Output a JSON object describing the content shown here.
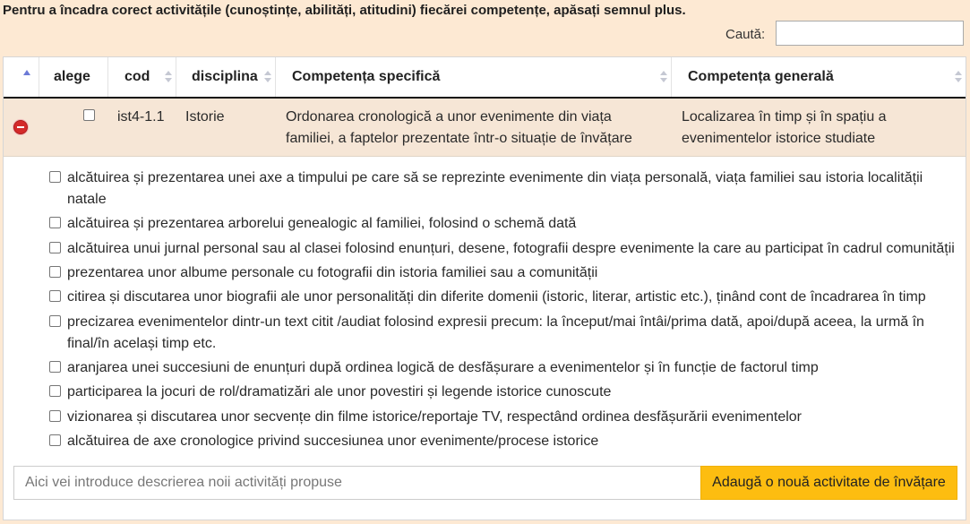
{
  "header": {
    "instructions": "Pentru a încadra corect activitățile (cunoștințe, abilități, atitudini) fiecărei competențe, apăsați semnul plus."
  },
  "search": {
    "label": "Caută:",
    "value": "",
    "placeholder": ""
  },
  "table": {
    "columns": {
      "alege": "alege",
      "cod": "cod",
      "disciplina": "disciplina",
      "competenta_specifica": "Competența specifică",
      "competenta_generala": "Competența generală"
    },
    "row": {
      "checked": false,
      "cod": "ist4-1.1",
      "disciplina": "Istorie",
      "competenta_specifica": "Ordonarea cronologică a unor evenimente din viața familiei, a faptelor prezentate într-o situație de învățare",
      "competenta_generala": "Localizarea în timp și în spațiu a evenimentelor istorice studiate"
    }
  },
  "activities": [
    {
      "text": "alcătuirea și prezentarea unei axe a timpului pe care să se reprezinte evenimente din viața personală, viața familiei sau istoria localității natale",
      "checked": false
    },
    {
      "text": "alcătuirea și prezentarea arborelui genealogic al familiei, folosind o schemă dată",
      "checked": false
    },
    {
      "text": "alcătuirea unui jurnal personal sau al clasei folosind enunțuri, desene, fotografii despre evenimente la care au participat în cadrul comunității",
      "checked": false
    },
    {
      "text": "prezentarea unor albume personale cu fotografii din istoria familiei sau a comunității",
      "checked": false
    },
    {
      "text": "citirea și discutarea unor biografii ale unor personalități din diferite domenii (istoric, literar, artistic etc.), ținând cont de încadrarea în timp",
      "checked": false
    },
    {
      "text": "precizarea evenimentelor dintr-un text citit /audiat folosind expresii precum: la început/mai întâi/prima dată, apoi/după aceea, la urmă în final/în același timp etc.",
      "checked": false
    },
    {
      "text": "aranjarea unei succesiuni de enunțuri după ordinea logică de desfășurare a evenimentelor și în funcție de factorul timp",
      "checked": false
    },
    {
      "text": "participarea la jocuri de rol/dramatizări ale unor povestiri și legende istorice cunoscute",
      "checked": false
    },
    {
      "text": "vizionarea și discutarea unor secvențe din filme istorice/reportaje TV, respectând ordinea desfășurării evenimentelor",
      "checked": false
    },
    {
      "text": "alcătuirea de axe cronologice privind succesiunea unor evenimente/procese istorice",
      "checked": false
    }
  ],
  "new_activity": {
    "placeholder": "Aici vei introduce descrierea noii activități propuse",
    "value": "",
    "button_label": "Adaugă o nouă activitate de învățare"
  },
  "icons": {
    "collapse": "minus-circle-icon",
    "sort": "sort-arrows-icon",
    "sort_asc": "sort-asc-icon"
  },
  "colors": {
    "page_background": "#fde9d3",
    "row_background": "#f6e6d6",
    "button_accent": "#fdbd10",
    "collapse_icon": "#d42a2a"
  }
}
